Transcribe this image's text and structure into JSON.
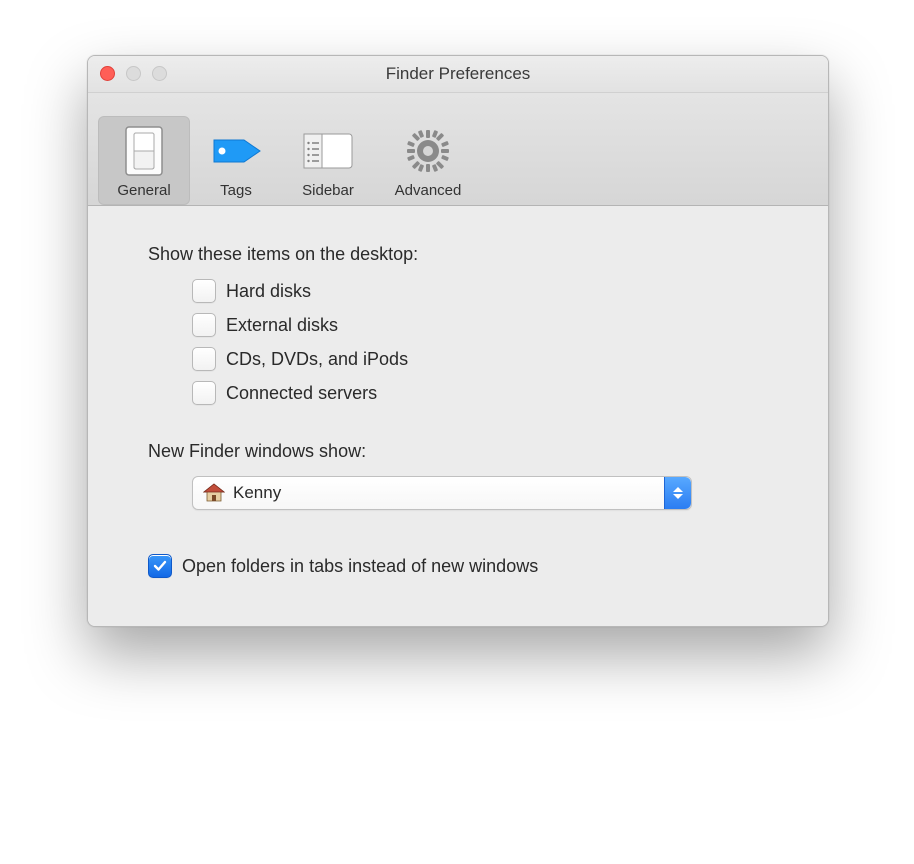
{
  "window": {
    "title": "Finder Preferences"
  },
  "toolbar": {
    "items": [
      {
        "label": "General",
        "selected": true
      },
      {
        "label": "Tags",
        "selected": false
      },
      {
        "label": "Sidebar",
        "selected": false
      },
      {
        "label": "Advanced",
        "selected": false
      }
    ]
  },
  "sections": {
    "show_items_label": "Show these items on the desktop:",
    "show_items": [
      {
        "label": "Hard disks",
        "checked": false
      },
      {
        "label": "External disks",
        "checked": false
      },
      {
        "label": "CDs, DVDs, and iPods",
        "checked": false
      },
      {
        "label": "Connected servers",
        "checked": false
      }
    ],
    "new_windows_label": "New Finder windows show:",
    "new_windows_value": "Kenny",
    "open_in_tabs": {
      "label": "Open folders in tabs instead of new windows",
      "checked": true
    }
  }
}
